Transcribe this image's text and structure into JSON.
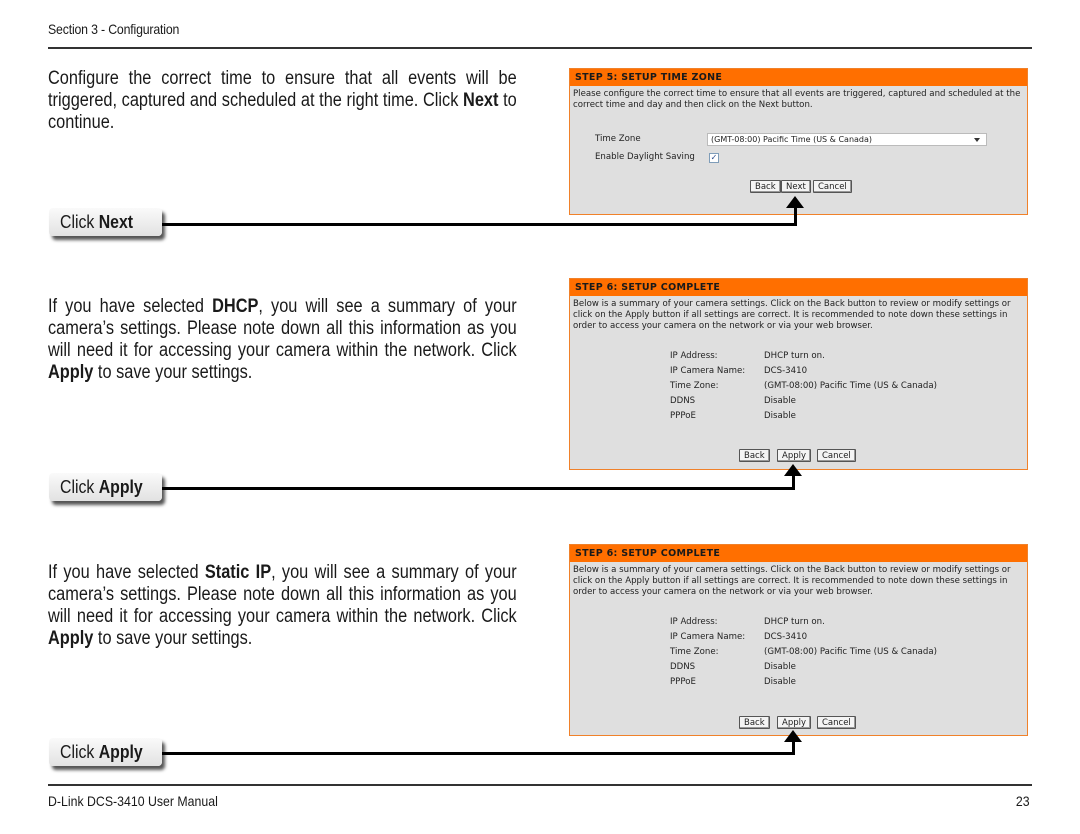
{
  "header": {
    "section": "Section 3 - Configuration"
  },
  "blocks": [
    {
      "paragraph": [
        "Configure the correct time to ensure that all events will be triggered, captured and scheduled at the right time. Click ",
        "Next",
        " to continue."
      ],
      "callout": {
        "prefix": "Click ",
        "action": "Next"
      }
    },
    {
      "paragraph": [
        "If you have selected ",
        "DHCP",
        ", you will see a summary of your camera’s settings. Please note down all this information as you will need it for accessing your camera within the network. Click ",
        "Apply",
        " to save your settings."
      ],
      "callout": {
        "prefix": "Click ",
        "action": "Apply"
      }
    },
    {
      "paragraph": [
        "If you have selected ",
        "Static IP",
        ", you will see a summary of your camera’s settings. Please note down all this information as you will need it for accessing your camera within the network. Click ",
        "Apply",
        " to save your settings."
      ],
      "callout": {
        "prefix": "Click ",
        "action": "Apply"
      }
    }
  ],
  "panel_timezone": {
    "title": "STEP 5: SETUP TIME ZONE",
    "description": "Please configure the correct time to ensure that all events are triggered, captured and scheduled at the correct time and day and then click on the Next button.",
    "timezone_label": "Time Zone",
    "timezone_value": "(GMT-08:00) Pacific Time (US & Canada)",
    "dst_label": "Enable Daylight Saving",
    "dst_checked": "✓",
    "buttons": {
      "back": "Back",
      "next": "Next",
      "cancel": "Cancel"
    }
  },
  "panel_complete_dhcp": {
    "title": "STEP 6: SETUP COMPLETE",
    "description": "Below is a summary of your camera settings. Click on the Back button to review or modify settings or click on the Apply button if all settings are correct. It is recommended to note down these settings in order to access your camera on the network or via your web browser.",
    "summary": [
      {
        "label": "IP Address:",
        "value": "DHCP turn on."
      },
      {
        "label": "IP Camera Name:",
        "value": "DCS-3410"
      },
      {
        "label": "Time Zone:",
        "value": "(GMT-08:00) Pacific Time (US & Canada)"
      },
      {
        "label": "DDNS",
        "value": "Disable"
      },
      {
        "label": "PPPoE",
        "value": "Disable"
      }
    ],
    "buttons": {
      "back": "Back",
      "apply": "Apply",
      "cancel": "Cancel"
    }
  },
  "panel_complete_static": {
    "title": "STEP 6: SETUP COMPLETE",
    "description": "Below is a summary of your camera settings. Click on the Back button to review or modify settings or click on the Apply button if all settings are correct. It is recommended to note down these settings in order to access your camera on the network or via your web browser.",
    "summary": [
      {
        "label": "IP Address:",
        "value": "DHCP turn on."
      },
      {
        "label": "IP Camera Name:",
        "value": "DCS-3410"
      },
      {
        "label": "Time Zone:",
        "value": "(GMT-08:00) Pacific Time (US & Canada)"
      },
      {
        "label": "DDNS",
        "value": "Disable"
      },
      {
        "label": "PPPoE",
        "value": "Disable"
      }
    ],
    "buttons": {
      "back": "Back",
      "apply": "Apply",
      "cancel": "Cancel"
    }
  },
  "footer": {
    "manual": "D-Link DCS-3410 User Manual",
    "page": "23"
  }
}
